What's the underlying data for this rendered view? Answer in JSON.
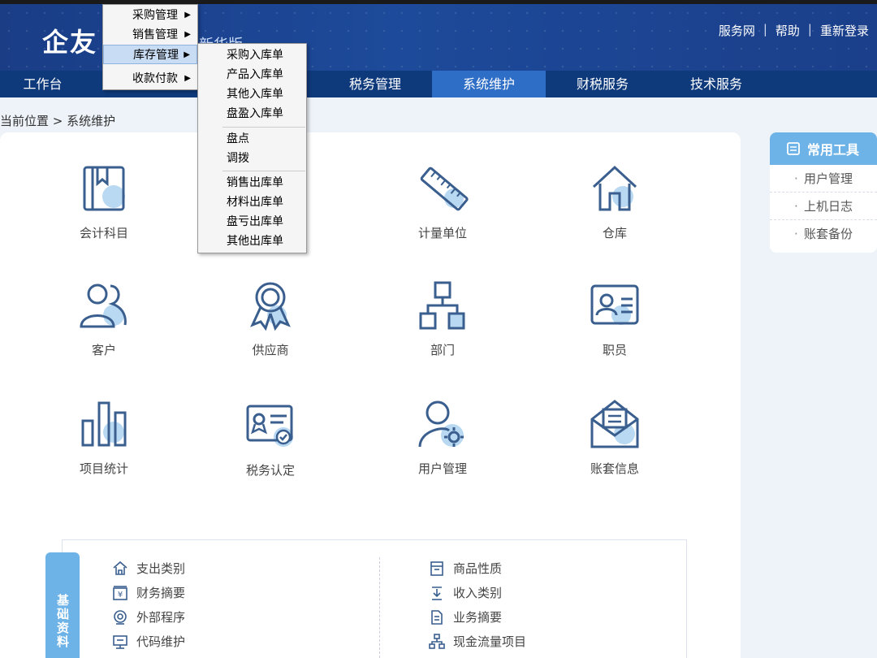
{
  "header": {
    "logo": "企友",
    "edition": "新华版",
    "links": [
      "服务网",
      "帮助",
      "重新登录"
    ]
  },
  "nav": {
    "items": [
      "工作台",
      "税务管理",
      "系统维护",
      "财税服务",
      "技术服务"
    ],
    "active": "系统维护"
  },
  "breadcrumb": "当前位置 > 系统维护",
  "tiles": [
    "会计科目",
    "计量单位",
    "仓库",
    "客户",
    "供应商",
    "部门",
    "职员",
    "项目统计",
    "税务认定",
    "用户管理",
    "账套信息"
  ],
  "basic": {
    "tab_label": "基础资料",
    "left": [
      "支出类别",
      "财务摘要",
      "外部程序",
      "代码维护"
    ],
    "right": [
      "商品性质",
      "收入类别",
      "业务摘要",
      "现金流量项目"
    ]
  },
  "tools": {
    "title": "常用工具",
    "items": [
      "用户管理",
      "上机日志",
      "账套备份"
    ]
  },
  "menu1": {
    "items": [
      "采购管理",
      "销售管理",
      "库存管理",
      "收款付款"
    ],
    "selected": "库存管理"
  },
  "menu2": {
    "groups": [
      [
        "采购入库单",
        "产品入库单",
        "其他入库单",
        "盘盈入库单"
      ],
      [
        "盘点",
        "调拨"
      ],
      [
        "销售出库单",
        "材料出库单",
        "盘亏出库单",
        "其他出库单"
      ]
    ]
  },
  "colors": {
    "header": "#1d4a9a",
    "nav": "#0e3a7c",
    "nav_active": "#2f6ec7",
    "accent": "#6db3e8",
    "icon_line": "#3a5f8f",
    "icon_fill": "#b9d9f3"
  }
}
